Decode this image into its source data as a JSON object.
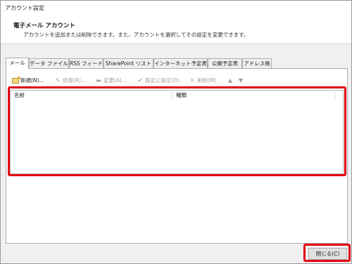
{
  "window": {
    "title": "アカウント設定"
  },
  "header": {
    "title": "電子メール アカウント",
    "description": "アカウントを追加または削除できます。また、アカウントを選択してその設定を変更できます。"
  },
  "tabs": [
    {
      "label": "メール",
      "active": true
    },
    {
      "label": "データ ファイル",
      "active": false
    },
    {
      "label": "RSS フィード",
      "active": false
    },
    {
      "label": "SharePoint リスト",
      "active": false
    },
    {
      "label": "インターネット予定表",
      "active": false
    },
    {
      "label": "公開予定表",
      "active": false
    },
    {
      "label": "アドレス帳",
      "active": false
    }
  ],
  "toolbar": {
    "new_label": "新規(N)...",
    "repair_label": "修復(R)...",
    "change_label": "変更(A)...",
    "default_label": "既定に設定(D)",
    "remove_label": "削除(M)",
    "up_glyph": "▲",
    "down_glyph": "▼"
  },
  "list": {
    "columns": [
      "名前",
      "種類"
    ],
    "rows": []
  },
  "footer": {
    "close_label": "閉じる(C)"
  },
  "colors": {
    "highlight": "#e3000f"
  }
}
